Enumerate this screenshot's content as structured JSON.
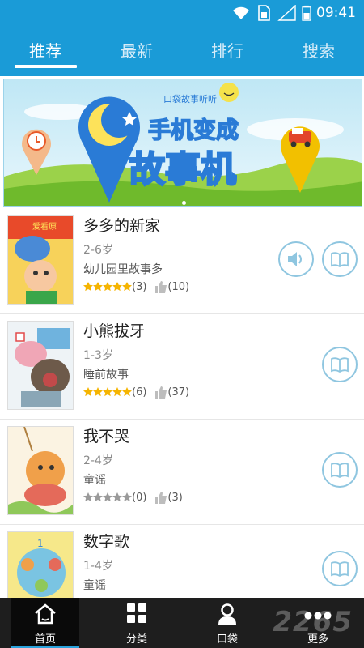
{
  "status_bar": {
    "time": "09:41"
  },
  "tabs": [
    {
      "label": "推荐"
    },
    {
      "label": "最新"
    },
    {
      "label": "排行"
    },
    {
      "label": "搜索"
    }
  ],
  "banner": {
    "small_text": "口袋故事听听",
    "headline_line1": "手机变成",
    "headline_line2": "故事机"
  },
  "stories": [
    {
      "title": "多多的新家",
      "age": "2-6岁",
      "category": "幼儿园里故事多",
      "rating_count": "(3)",
      "likes": "(10)",
      "rating": 5,
      "has_audio": true,
      "cover_text": "爱看原"
    },
    {
      "title": "小熊拔牙",
      "age": "1-3岁",
      "category": "睡前故事",
      "rating_count": "(6)",
      "likes": "(37)",
      "rating": 5,
      "has_audio": false
    },
    {
      "title": "我不哭",
      "age": "2-4岁",
      "category": "童谣",
      "rating_count": "(0)",
      "likes": "(3)",
      "rating": 0,
      "has_audio": false
    },
    {
      "title": "数字歌",
      "age": "1-4岁",
      "category": "童谣",
      "rating_count": "",
      "likes": "",
      "rating": 0,
      "has_audio": false
    }
  ],
  "bottom_nav": [
    {
      "label": "首页",
      "icon": "home-icon"
    },
    {
      "label": "分类",
      "icon": "grid-icon"
    },
    {
      "label": "口袋",
      "icon": "person-icon"
    },
    {
      "label": "更多",
      "icon": "more-icon"
    }
  ],
  "watermark": "2265",
  "colors": {
    "primary": "#1a9bd7",
    "star": "#f5b400",
    "star_empty": "#9a9a9a",
    "outline": "#8fc6e0",
    "nav_bg": "#1e1e1e"
  }
}
